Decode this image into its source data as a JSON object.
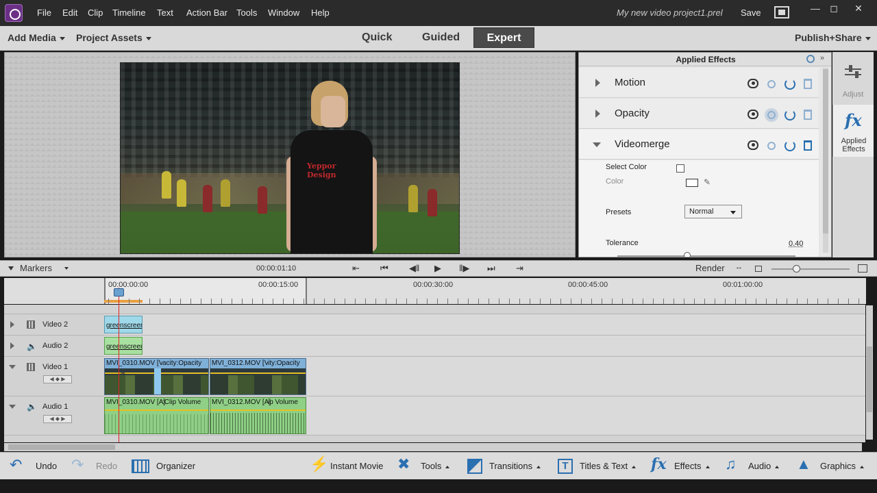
{
  "menubar": {
    "items": [
      "File",
      "Edit",
      "Clip",
      "Timeline",
      "Text",
      "Action Bar",
      "Tools",
      "Window",
      "Help"
    ],
    "project_title": "My new video project1.prel",
    "save_label": "Save"
  },
  "modebar": {
    "add_media": "Add Media",
    "project_assets": "Project Assets",
    "tabs": [
      "Quick",
      "Guided",
      "Expert"
    ],
    "active_tab": "Expert",
    "publish": "Publish+Share"
  },
  "video": {
    "shirt_logo": "Yeppor Design"
  },
  "applied_effects": {
    "title": "Applied Effects",
    "effects": [
      {
        "name": "Motion",
        "expanded": false
      },
      {
        "name": "Opacity",
        "expanded": false
      },
      {
        "name": "Videomerge",
        "expanded": true
      }
    ],
    "videomerge": {
      "select_color_label": "Select Color",
      "color_label": "Color",
      "presets_label": "Presets",
      "presets_value": "Normal",
      "tolerance_label": "Tolerance",
      "tolerance_value": "0.40"
    }
  },
  "side_tabs": [
    {
      "label": "Adjust",
      "icon": "sliders-icon"
    },
    {
      "label": "Applied Effects",
      "icon": "fx-icon"
    }
  ],
  "timeline_toolbar": {
    "markers_label": "Markers",
    "timecode": "00:00:01:10",
    "render_label": "Render"
  },
  "ruler": {
    "labels": [
      "00:00:00:00",
      "00:00:15:00",
      "00:00:30:00",
      "00:00:45:00",
      "00:01:00:00"
    ]
  },
  "tracks": [
    {
      "name": "Video 2",
      "clips": [
        "greenscreen"
      ]
    },
    {
      "name": "Audio 2",
      "clips": [
        "greenscreen"
      ]
    },
    {
      "name": "Video 1",
      "clips": [
        "MVI_0310.MOV [V]",
        "acity:Opacity",
        "MVI_0312.MOV [V]",
        "ity:Opacity"
      ]
    },
    {
      "name": "Audio 1",
      "clips": [
        "MVI_0310.MOV [A]",
        ":Clip Volume",
        "MVI_0312.MOV [A]",
        "ip Volume"
      ]
    }
  ],
  "actionbar": {
    "undo": "Undo",
    "redo": "Redo",
    "organizer": "Organizer",
    "instant_movie": "Instant Movie",
    "tools": "Tools",
    "transitions": "Transitions",
    "titles_text": "Titles & Text",
    "effects": "Effects",
    "audio": "Audio",
    "graphics": "Graphics"
  }
}
